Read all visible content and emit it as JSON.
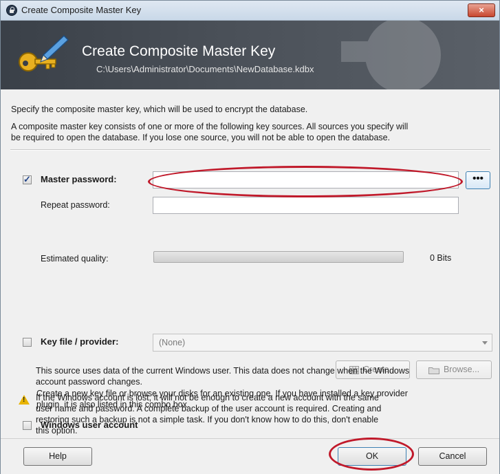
{
  "window": {
    "title": "Create Composite Master Key",
    "close_label": "×"
  },
  "banner": {
    "title": "Create Composite Master Key",
    "path": "C:\\Users\\Administrator\\Documents\\NewDatabase.kdbx"
  },
  "intro": {
    "line1": "Specify the composite master key, which will be used to encrypt the database.",
    "line2a": "A composite master key consists of one or more of the following key sources. All sources you specify will",
    "line2b": "be required to open the database.  If you lose one source, you will not be able to open the database."
  },
  "master_password": {
    "checked": true,
    "check_mark": "✓",
    "label": "Master password:",
    "value": "",
    "show_button_label": "•••",
    "repeat_label": "Repeat password:",
    "repeat_value": "",
    "quality_label": "Estimated quality:",
    "quality_fraction": 0,
    "bits_label": "0 Bits"
  },
  "key_file": {
    "checked": false,
    "label": "Key file / provider:",
    "selected": "(None)",
    "create_label": "Create...",
    "browse_label": "Browse...",
    "help1": "Create a new key file or browse your disks for an existing one. If you have installed a key provider",
    "help2": "plugin, it is also listed in this combo box."
  },
  "windows_account": {
    "checked": false,
    "label": "Windows user account",
    "desc1": "This source uses data of the current Windows user. This data does not change when the Windows",
    "desc2": "account password changes.",
    "warn1": "If the Windows account is lost, it will not be enough to create a new account with the same",
    "warn2": "user name and password. A complete backup of the user account is required. Creating and",
    "warn3": "restoring such a backup is not a simple task. If you don't know how to do this, don't enable",
    "warn4": "this option."
  },
  "buttons": {
    "help": "Help",
    "ok": "OK",
    "cancel": "Cancel"
  },
  "colors": {
    "annotation": "#c0192a",
    "banner_bg": "#3a4048",
    "progress_fill": "#3cb043"
  }
}
